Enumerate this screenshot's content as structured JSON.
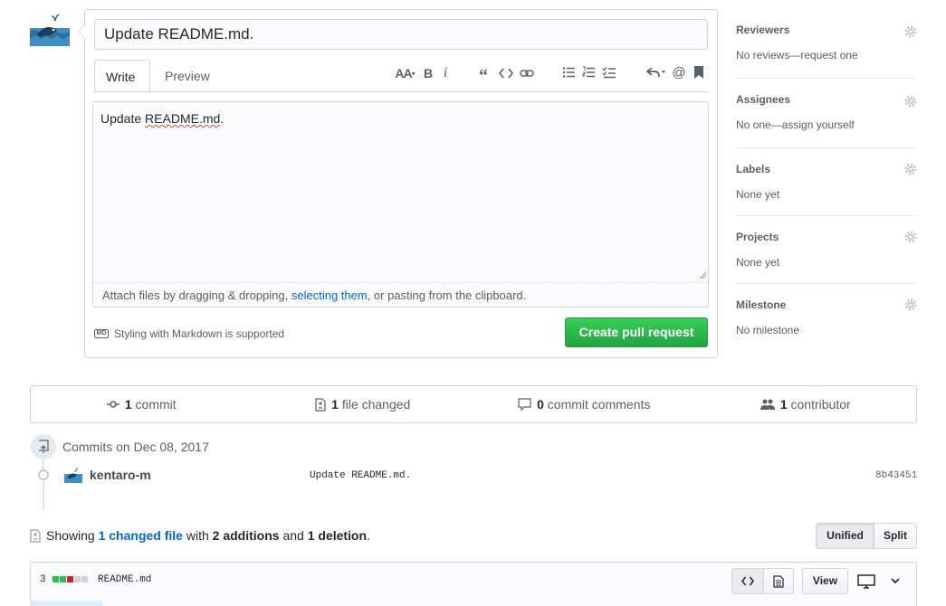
{
  "composer": {
    "title_value": "Update README.md.",
    "tabs": [
      {
        "label": "Write"
      },
      {
        "label": "Preview"
      }
    ],
    "body_prefix": "Update ",
    "body_misspelled": "README.md",
    "body_suffix": ".",
    "attach": {
      "prefix": "Attach files by dragging & dropping, ",
      "link": "selecting them",
      "suffix": ", or pasting from the clipboard."
    },
    "markdown_badge": "MD",
    "markdown_note": "Styling with Markdown is supported",
    "create_button": "Create pull request",
    "toolbar": {
      "heading_label": "AA",
      "bold_label": "B",
      "italic_label": "i"
    }
  },
  "sidebar": [
    {
      "title": "Reviewers",
      "value": "No reviews—request one"
    },
    {
      "title": "Assignees",
      "value": "No one—assign yourself"
    },
    {
      "title": "Labels",
      "value": "None yet"
    },
    {
      "title": "Projects",
      "value": "None yet"
    },
    {
      "title": "Milestone",
      "value": "No milestone"
    }
  ],
  "stats": {
    "commits_count": "1",
    "commits_label": "commit",
    "files_count": "1",
    "files_label": "file changed",
    "comments_count": "0",
    "comments_label": "commit comments",
    "contributors_count": "1",
    "contributors_label": "contributor"
  },
  "commits": {
    "heading": "Commits on Dec 08, 2017",
    "items": [
      {
        "author": "kentaro-m",
        "message": "Update README.md.",
        "sha": "8b43451"
      }
    ]
  },
  "diff_summary": {
    "showing": "Showing",
    "changed_link": "1 changed file",
    "with": "with",
    "additions": "2 additions",
    "and": "and",
    "deletions": "1 deletion",
    "period": ".",
    "view_unified": "Unified",
    "view_split": "Split"
  },
  "file": {
    "change_count": "3",
    "name": "README.md",
    "blocks": [
      "added",
      "added",
      "deleted",
      "neutral",
      "neutral"
    ],
    "view_button": "View"
  },
  "colors": {
    "added": "#2cbe4e",
    "deleted": "#cb2431",
    "neutral": "#d1d5da",
    "primary_green": "#28a745",
    "link_blue": "#0366d6"
  },
  "icons": {
    "commit": "git-commit-icon",
    "file": "file-diff-icon",
    "comment": "comment-icon",
    "contributors": "people-icon",
    "settings": "gear-icon"
  }
}
